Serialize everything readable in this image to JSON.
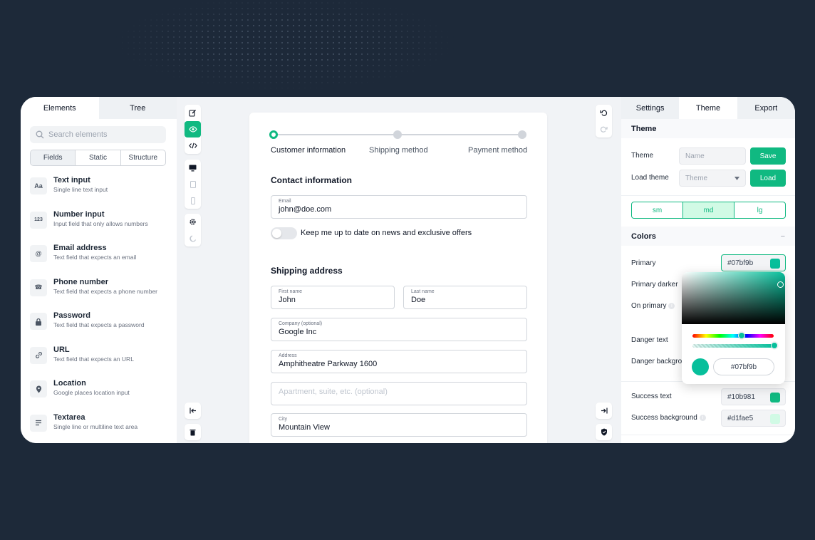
{
  "left_panel": {
    "tabs": [
      "Elements",
      "Tree"
    ],
    "search_placeholder": "Search elements",
    "segments": [
      "Fields",
      "Static",
      "Structure"
    ],
    "items": [
      {
        "icon_text": "Aa",
        "icon": "text-icon",
        "title": "Text input",
        "sub": "Single line text input"
      },
      {
        "icon_text": "123",
        "icon": "number-icon",
        "title": "Number input",
        "sub": "Input field that only allows numbers"
      },
      {
        "icon_text": "@",
        "icon": "at-icon",
        "title": "Email address",
        "sub": "Text field that expects an email"
      },
      {
        "icon_text": "☎",
        "icon": "phone-icon",
        "title": "Phone number",
        "sub": "Text field that expects a phone number"
      },
      {
        "icon_text": "🔒",
        "icon": "lock-icon",
        "title": "Password",
        "sub": "Text field that expects a password"
      },
      {
        "icon_text": "🔗",
        "icon": "link-icon",
        "title": "URL",
        "sub": "Text field that expects an URL"
      },
      {
        "icon_text": "⬤",
        "icon": "location-pin-icon",
        "title": "Location",
        "sub": "Google places location input"
      },
      {
        "icon_text": "≡",
        "icon": "textarea-icon",
        "title": "Textarea",
        "sub": "Single line or multiline text area"
      }
    ]
  },
  "form": {
    "steps": [
      "Customer information",
      "Shipping method",
      "Payment method"
    ],
    "contact_title": "Contact information",
    "email": {
      "label": "Email",
      "value": "john@doe.com"
    },
    "newsletter_label": "Keep me up to date on news and exclusive offers",
    "shipping_title": "Shipping address",
    "first_name": {
      "label": "First name",
      "value": "John"
    },
    "last_name": {
      "label": "Last name",
      "value": "Doe"
    },
    "company": {
      "label": "Company (optional)",
      "value": "Google Inc"
    },
    "address": {
      "label": "Address",
      "value": "Amphitheatre Parkway 1600"
    },
    "apartment_placeholder": "Apartment, suite, etc. (optional)",
    "city": {
      "label": "City",
      "value": "Mountain View"
    }
  },
  "right_panel": {
    "tabs": [
      "Settings",
      "Theme",
      "Export"
    ],
    "theme_section": "Theme",
    "theme_label": "Theme",
    "theme_name_placeholder": "Name",
    "save_label": "Save",
    "load_theme_label": "Load theme",
    "load_select_value": "Theme",
    "load_label": "Load",
    "sizes": [
      "sm",
      "md",
      "lg"
    ],
    "colors_section": "Colors",
    "colors_toggle": "−",
    "primary_label": "Primary",
    "primary_value": "#07bf9b",
    "primary_darker_label": "Primary darker",
    "on_primary_label": "On primary",
    "danger_text_label": "Danger text",
    "danger_background_label": "Danger background",
    "success_text_label": "Success text",
    "success_text_value": "#10b981",
    "success_background_label": "Success background",
    "success_background_value": "#d1fae5",
    "picker_hex": "#07bf9b"
  },
  "colors": {
    "accent": "#10b981",
    "primary": "#07bf9b",
    "success_bg": "#d1fae5"
  }
}
